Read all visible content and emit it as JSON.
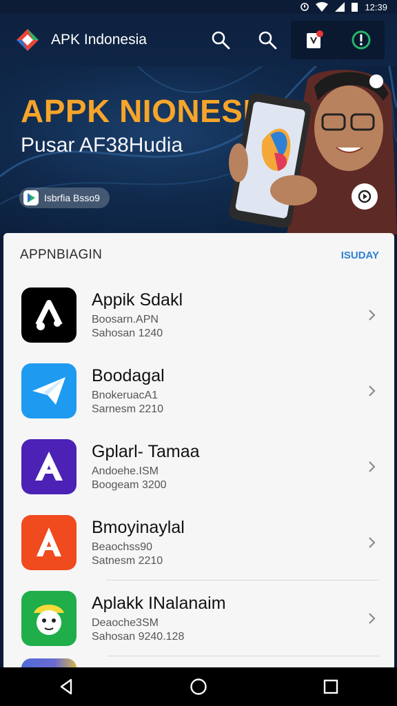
{
  "status_bar": {
    "time": "12:39"
  },
  "app_bar": {
    "title": "APK Indonesia",
    "icons": [
      "search-icon",
      "search-icon",
      "bookmark-icon",
      "power-icon"
    ],
    "notification_badge": "•"
  },
  "hero": {
    "title": "APPK NIONESIA",
    "subtitle": "Pusar AF38Hudia",
    "chip_label": "Isbrfia Bsso9"
  },
  "section": {
    "title": "APPNBIAGIN",
    "action": "ISUDAY"
  },
  "apps": [
    {
      "name": "Appik Sdakl",
      "line1": "Boosarn.APN",
      "line2": "Sahosan 1240",
      "color": "#000000",
      "icon": "music-note-icon"
    },
    {
      "name": "Boodagal",
      "line1": "BnokeruacA1",
      "line2": "Sarnesm 2210",
      "color": "#1e9bf0",
      "icon": "paper-plane-icon"
    },
    {
      "name": "Gplarl- Tamaa",
      "line1": "Andoehe.ISM",
      "line2": "Boogeam 3200",
      "color": "#4b22b5",
      "icon": "letter-a-icon"
    },
    {
      "name": "Bmoyinaylal",
      "line1": "Beaochss90",
      "line2": "Satnesm 2210",
      "color": "#f04a1f",
      "icon": "letter-a-icon"
    },
    {
      "name": "Aplakk INalanaim",
      "line1": "Deaoche3SM",
      "line2": "Sahosan 9240.128",
      "color": "#1fae4a",
      "icon": "character-icon"
    }
  ],
  "colors": {
    "accent": "#f6a52a",
    "link": "#2d7fd3",
    "header_bg": "#0e213f"
  }
}
